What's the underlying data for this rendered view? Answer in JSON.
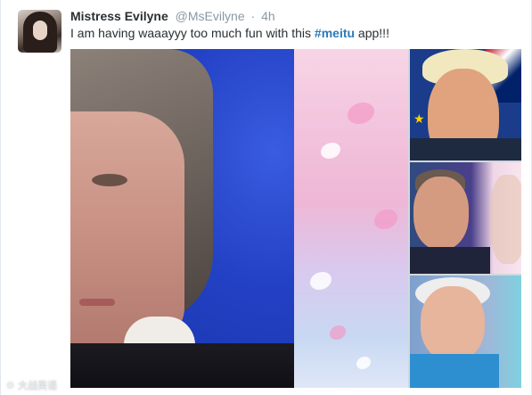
{
  "tweet": {
    "author_name": "Mistress Evilyne",
    "handle": "@MsEvilyne",
    "separator": "·",
    "time": "4h",
    "text_before": "I am having waaayyy too much fun with this ",
    "hashtag": "#meitu",
    "text_after": " app!!!"
  },
  "media": {
    "images": [
      {
        "role": "main-photo"
      },
      {
        "role": "side-photo-1"
      },
      {
        "role": "side-photo-2"
      },
      {
        "role": "side-photo-3"
      }
    ]
  },
  "watermark": "☉ 大战英语"
}
